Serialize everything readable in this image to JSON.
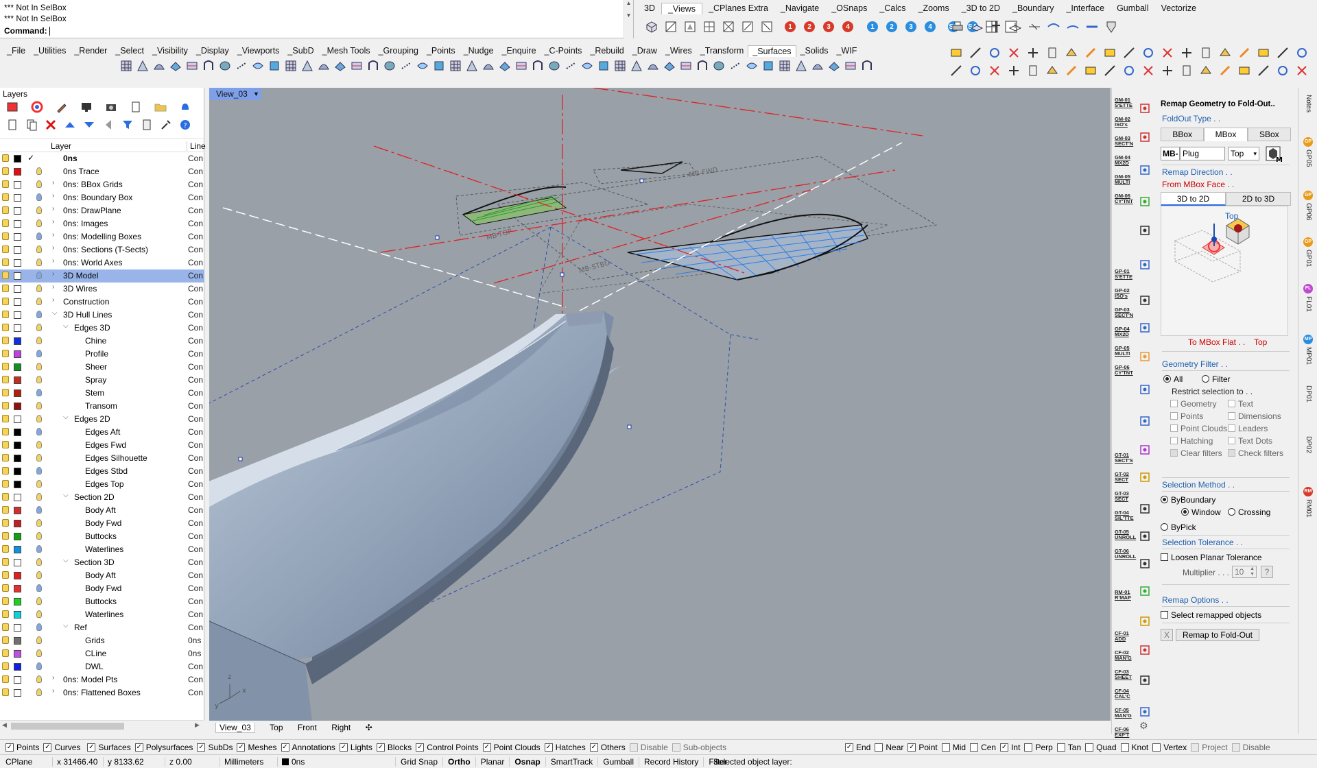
{
  "command": {
    "history": [
      "*** Not In SelBox",
      "*** Not In SelBox"
    ],
    "prompt": "Command:"
  },
  "top_tabs": [
    "3D",
    "_Views",
    "_CPlanes Extra",
    "_Navigate",
    "_OSnaps",
    "_Calcs",
    "_Zooms",
    "_3D to 2D",
    "_Boundary",
    "_Interface",
    "Gumball",
    "Vectorize"
  ],
  "top_tabs_active": "_Views",
  "view_numbers_red": [
    "1",
    "2",
    "3",
    "4"
  ],
  "view_numbers_blue": [
    "1",
    "2",
    "3",
    "4"
  ],
  "menu_tabs": [
    "_File",
    "_Utilities",
    "_Render",
    "_Select",
    "_Visibility",
    "_Display",
    "_Viewports",
    "_SubD",
    "_Mesh Tools",
    "_Grouping",
    "_Points",
    "_Nudge",
    "_Enquire",
    "_C-Points",
    "_Rebuild",
    "_Draw",
    "_Wires",
    "_Transform",
    "_Surfaces",
    "_Solids",
    "_WIF"
  ],
  "menu_tabs_active": "_Surfaces",
  "layers": {
    "title": "Layers",
    "col_layer": "Layer",
    "col_line": "Line",
    "rows": [
      {
        "name": "0ns",
        "indent": 0,
        "color": "#000000",
        "bold": true,
        "current": true,
        "line": "Con",
        "arrow": ""
      },
      {
        "name": "0ns Trace",
        "indent": 0,
        "color": "#e01010",
        "line": "Con",
        "arrow": ""
      },
      {
        "name": "0ns: BBox Grids",
        "indent": 0,
        "color": "#ffffff",
        "line": "Con",
        "arrow": ">"
      },
      {
        "name": "0ns: Boundary Box",
        "indent": 0,
        "color": "#ffffff",
        "line": "Con",
        "arrow": ">"
      },
      {
        "name": "0ns: DrawPlane",
        "indent": 0,
        "color": "#ffffff",
        "line": "Con",
        "arrow": ">"
      },
      {
        "name": "0ns: Images",
        "indent": 0,
        "color": "#ffffff",
        "line": "Con",
        "arrow": ">"
      },
      {
        "name": "0ns: Modelling Boxes",
        "indent": 0,
        "color": "#ffffff",
        "line": "Con",
        "arrow": ">"
      },
      {
        "name": "0ns: Sections (T-Sects)",
        "indent": 0,
        "color": "#ffffff",
        "line": "Con",
        "arrow": ">"
      },
      {
        "name": "0ns: World Axes",
        "indent": 0,
        "color": "#ffffff",
        "line": "Con",
        "arrow": ">"
      },
      {
        "name": "3D Model",
        "indent": 0,
        "color": "#ffffff",
        "line": "Con",
        "arrow": ">",
        "selected": true
      },
      {
        "name": "3D Wires",
        "indent": 0,
        "color": "#ffffff",
        "line": "Con",
        "arrow": ">"
      },
      {
        "name": "Construction",
        "indent": 0,
        "color": "#ffffff",
        "line": "Con",
        "arrow": ">"
      },
      {
        "name": "3D Hull Lines",
        "indent": 0,
        "color": "#ffffff",
        "line": "Con",
        "arrow": "v"
      },
      {
        "name": "Edges 3D",
        "indent": 1,
        "color": "#ffffff",
        "line": "Con",
        "arrow": "v"
      },
      {
        "name": "Chine",
        "indent": 2,
        "color": "#1030e0",
        "line": "Con",
        "arrow": ""
      },
      {
        "name": "Profile",
        "indent": 2,
        "color": "#c040e0",
        "line": "Con",
        "arrow": ""
      },
      {
        "name": "Sheer",
        "indent": 2,
        "color": "#109020",
        "line": "Con",
        "arrow": ""
      },
      {
        "name": "Spray",
        "indent": 2,
        "color": "#c03020",
        "line": "Con",
        "arrow": ""
      },
      {
        "name": "Stem",
        "indent": 2,
        "color": "#b02010",
        "line": "Con",
        "arrow": ""
      },
      {
        "name": "Transom",
        "indent": 2,
        "color": "#901010",
        "line": "Con",
        "arrow": ""
      },
      {
        "name": "Edges 2D",
        "indent": 1,
        "color": "#ffffff",
        "line": "Con",
        "arrow": "v"
      },
      {
        "name": "Edges Aft",
        "indent": 2,
        "color": "#000000",
        "line": "Con",
        "arrow": ""
      },
      {
        "name": "Edges Fwd",
        "indent": 2,
        "color": "#000000",
        "line": "Con",
        "arrow": ""
      },
      {
        "name": "Edges Silhouette",
        "indent": 2,
        "color": "#000000",
        "line": "Con",
        "arrow": ""
      },
      {
        "name": "Edges Stbd",
        "indent": 2,
        "color": "#000000",
        "line": "Con",
        "arrow": ""
      },
      {
        "name": "Edges Top",
        "indent": 2,
        "color": "#000000",
        "line": "Con",
        "arrow": ""
      },
      {
        "name": "Section 2D",
        "indent": 1,
        "color": "#ffffff",
        "line": "Con",
        "arrow": "v"
      },
      {
        "name": "Body Aft",
        "indent": 2,
        "color": "#d03030",
        "line": "Con",
        "arrow": ""
      },
      {
        "name": "Body Fwd",
        "indent": 2,
        "color": "#c02020",
        "line": "Con",
        "arrow": ""
      },
      {
        "name": "Buttocks",
        "indent": 2,
        "color": "#10a010",
        "line": "Con",
        "arrow": ""
      },
      {
        "name": "Waterlines",
        "indent": 2,
        "color": "#1090e0",
        "line": "Con",
        "arrow": ""
      },
      {
        "name": "Section 3D",
        "indent": 1,
        "color": "#ffffff",
        "line": "Con",
        "arrow": "v"
      },
      {
        "name": "Body Aft",
        "indent": 2,
        "color": "#e02020",
        "line": "Con",
        "arrow": ""
      },
      {
        "name": "Body Fwd",
        "indent": 2,
        "color": "#e03030",
        "line": "Con",
        "arrow": ""
      },
      {
        "name": "Buttocks",
        "indent": 2,
        "color": "#20d020",
        "line": "Con",
        "arrow": ""
      },
      {
        "name": "Waterlines",
        "indent": 2,
        "color": "#10d0e0",
        "line": "Con",
        "arrow": ""
      },
      {
        "name": "Ref",
        "indent": 1,
        "color": "#ffffff",
        "line": "Con",
        "arrow": "v"
      },
      {
        "name": "Grids",
        "indent": 2,
        "color": "#707070",
        "line": "0ns",
        "arrow": ""
      },
      {
        "name": "CLine",
        "indent": 2,
        "color": "#c050e0",
        "line": "0ns",
        "arrow": ""
      },
      {
        "name": "DWL",
        "indent": 2,
        "color": "#1020e0",
        "line": "Con",
        "arrow": ""
      },
      {
        "name": "0ns: Model Pts",
        "indent": 0,
        "color": "#ffffff",
        "line": "Con",
        "arrow": ">"
      },
      {
        "name": "0ns: Flattened Boxes",
        "indent": 0,
        "color": "#ffffff",
        "line": "Con",
        "arrow": ">"
      }
    ]
  },
  "viewport": {
    "name": "View_03",
    "labels": [
      "MB-STBD",
      "MB-TOP",
      "MB-FWD"
    ],
    "axis_labels": [
      "z",
      "y",
      "x"
    ]
  },
  "view_tabs": [
    "View_03",
    "Top",
    "Front",
    "Right"
  ],
  "filters": {
    "left": [
      {
        "label": "Points",
        "checked": true
      },
      {
        "label": "Curves",
        "checked": true
      },
      {
        "label": "Surfaces",
        "checked": true
      },
      {
        "label": "Polysurfaces",
        "checked": true
      },
      {
        "label": "SubDs",
        "checked": true
      },
      {
        "label": "Meshes",
        "checked": true
      },
      {
        "label": "Annotations",
        "checked": true
      },
      {
        "label": "Lights",
        "checked": true
      },
      {
        "label": "Blocks",
        "checked": true
      },
      {
        "label": "Control Points",
        "checked": true
      },
      {
        "label": "Point Clouds",
        "checked": true
      },
      {
        "label": "Hatches",
        "checked": true
      },
      {
        "label": "Others",
        "checked": true
      },
      {
        "label": "Disable",
        "checked": false,
        "disabled": true
      },
      {
        "label": "Sub-objects",
        "checked": false,
        "disabled": true
      }
    ],
    "right": [
      {
        "label": "End",
        "checked": true
      },
      {
        "label": "Near",
        "checked": false
      },
      {
        "label": "Point",
        "checked": true
      },
      {
        "label": "Mid",
        "checked": false
      },
      {
        "label": "Cen",
        "checked": false
      },
      {
        "label": "Int",
        "checked": true
      },
      {
        "label": "Perp",
        "checked": false
      },
      {
        "label": "Tan",
        "checked": false
      },
      {
        "label": "Quad",
        "checked": false
      },
      {
        "label": "Knot",
        "checked": false
      },
      {
        "label": "Vertex",
        "checked": false
      },
      {
        "label": "Project",
        "checked": false,
        "disabled": true
      },
      {
        "label": "Disable",
        "checked": false,
        "disabled": true
      }
    ]
  },
  "status": {
    "cplane": "CPlane",
    "x": "x 31466.40",
    "y": "y 8133.62",
    "z": "z 0.00",
    "units": "Millimeters",
    "layer": "0ns",
    "toggles": [
      "Grid Snap",
      "Ortho",
      "Planar",
      "Osnap",
      "SmartTrack",
      "Gumball",
      "Record History",
      "Filter"
    ],
    "bold_toggles": [
      "Ortho",
      "Osnap"
    ],
    "message": "Selected object layer:"
  },
  "strip_labels": [
    [
      "GM-01",
      "S'ETTE"
    ],
    [
      "GM-02",
      "ISO's"
    ],
    [
      "GM-03",
      "SECT'N"
    ],
    [
      "GM-04",
      "MX2D"
    ],
    [
      "GM-05",
      "MULTI"
    ],
    [
      "GM-06",
      "CY'TNT"
    ],
    [
      "GP-01",
      "S'ETTE"
    ],
    [
      "GP-02",
      "ISO's"
    ],
    [
      "GP-03",
      "SECT'N"
    ],
    [
      "GP-04",
      "MX2D"
    ],
    [
      "GP-05",
      "MULTI"
    ],
    [
      "GP-06",
      "CY'TNT"
    ],
    [
      "GT-01",
      "SECT'S"
    ],
    [
      "GT-02",
      "SECT"
    ],
    [
      "GT-03",
      "SECT"
    ],
    [
      "GT-04",
      "SIL'TTE"
    ],
    [
      "GT-05",
      "UNROLL"
    ],
    [
      "GT-06",
      "UNROLL"
    ],
    [
      "RM-01",
      "R'MAP"
    ],
    [
      "CF-01",
      "ADD"
    ],
    [
      "CF-02",
      "MAN'G"
    ],
    [
      "CF-03",
      "SHEET"
    ],
    [
      "CF-04",
      "CAL'C"
    ],
    [
      "CF-05",
      "MAN'G"
    ],
    [
      "CF-06",
      "EXP'T"
    ]
  ],
  "strip_uv": "UV",
  "remap": {
    "title": "Remap Geometry to Fold-Out..",
    "foldout_type": "FoldOut Type . .",
    "type_tabs": [
      "BBox",
      "MBox",
      "SBox"
    ],
    "type_active": "MBox",
    "mb_prefix": "MB-",
    "mb_value": "Plug",
    "face_select": "Top",
    "direction": "Remap Direction . .",
    "from_face": "From MBox Face . .",
    "dir_tabs": [
      "3D to 2D",
      "2D to 3D"
    ],
    "dir_active": "3D to 2D",
    "diagram_top": "Top",
    "to_flat": "To MBox Flat . .",
    "to_flat_value": "Top",
    "geo_filter": "Geometry Filter . .",
    "all": "All",
    "filter": "Filter",
    "restrict": "Restrict selection to . .",
    "filter_items": [
      "Geometry",
      "Text",
      "Points",
      "Dimensions",
      "Point Clouds",
      "Leaders",
      "Hatching",
      "Text Dots",
      "Clear filters",
      "Check filters"
    ],
    "sel_method": "Selection Method . .",
    "by_boundary": "ByBoundary",
    "window": "Window",
    "crossing": "Crossing",
    "by_pick": "ByPick",
    "sel_tol": "Selection Tolerance . .",
    "loosen": "Loosen Planar Tolerance",
    "multiplier": "Multiplier . . . x",
    "mult_value": "10",
    "help": "?",
    "options": "Remap Options . .",
    "select_remapped": "Select remapped objects",
    "x_btn": "X",
    "go_btn": "Remap to Fold-Out"
  },
  "side_tabs": [
    {
      "label": "Notes",
      "dot": ""
    },
    {
      "label": "GP05",
      "dot": "GP"
    },
    {
      "label": "GP06",
      "dot": "GP"
    },
    {
      "label": "GP01",
      "dot": "GP"
    },
    {
      "label": "FL01",
      "dot": "FL"
    },
    {
      "label": "MP01",
      "dot": "MP"
    },
    {
      "label": "DP01",
      "dot": ""
    },
    {
      "label": "DP02",
      "dot": ""
    },
    {
      "label": "RM01",
      "dot": "RM"
    }
  ]
}
